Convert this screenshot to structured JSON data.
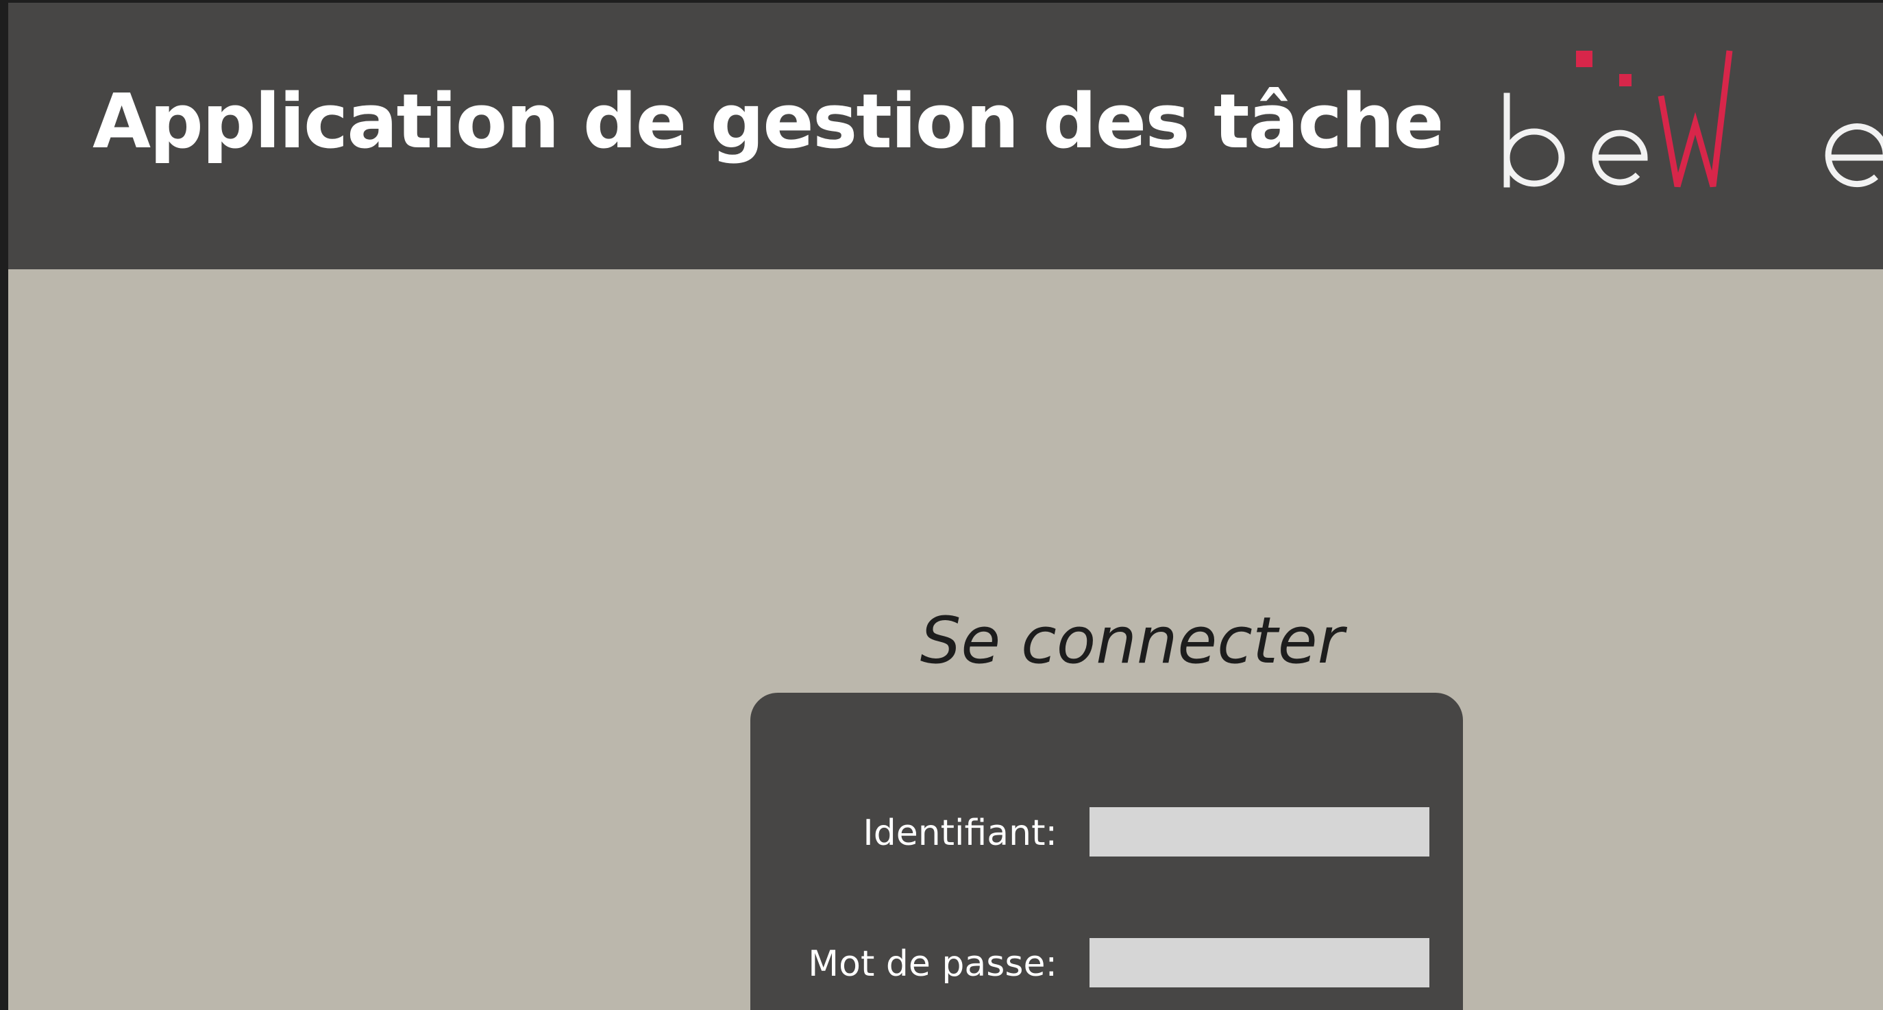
{
  "header": {
    "title": "Application de gestion des tâches",
    "logo": {
      "text": "beWe",
      "icon": "bewe-logo",
      "colors": {
        "letters_light": "#f2f2f2",
        "letters_accent": "#d8264a"
      }
    }
  },
  "login": {
    "heading": "Se connecter",
    "fields": {
      "username": {
        "label": "Identifiant:",
        "value": "",
        "placeholder": ""
      },
      "password": {
        "label": "Mot de passe:",
        "value": "",
        "placeholder": ""
      }
    }
  },
  "colors": {
    "header_background": "#474645",
    "page_background": "#bbb7ac",
    "card_background": "#474645",
    "input_background": "#d6d6d6",
    "title_text": "#ffffff",
    "heading_text": "#1d1d1d"
  }
}
